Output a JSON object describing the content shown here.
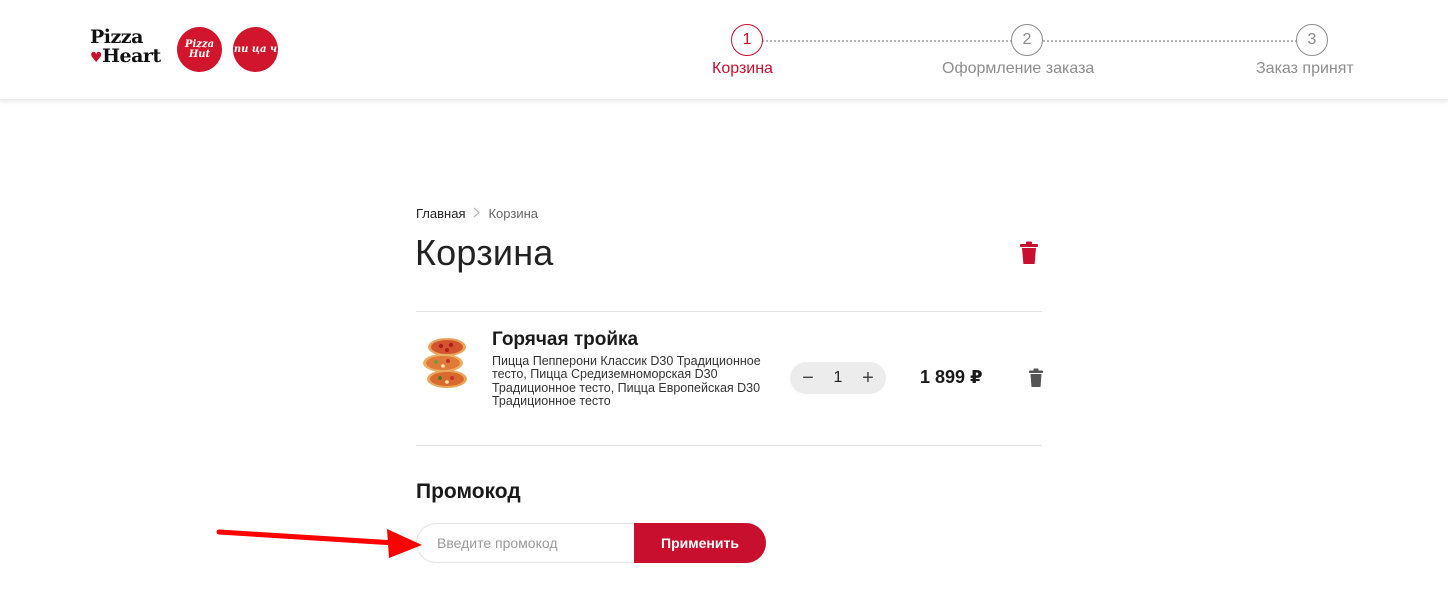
{
  "brand": {
    "logo_line1": "Pizza",
    "logo_heart": "♥",
    "logo_line2": "Heart",
    "logo_pizza_hut": "Pizza Hut",
    "logo_pitstsa": "пи ца ч"
  },
  "stepper": [
    {
      "number": "1",
      "label": "Корзина",
      "active": true
    },
    {
      "number": "2",
      "label": "Оформление заказа",
      "active": false
    },
    {
      "number": "3",
      "label": "Заказ принят",
      "active": false
    }
  ],
  "breadcrumb": {
    "home": "Главная",
    "current": "Корзина"
  },
  "page_title": "Корзина",
  "cart": {
    "items": [
      {
        "title": "Горячая тройка",
        "description": "Пицца Пепперони Классик D30 Традиционное тесто, Пицца Средиземноморская D30 Традиционное тесто, Пицца Европейская D30 Традиционное тесто",
        "quantity": "1",
        "price": "1 899 ₽",
        "minus": "−",
        "plus": "+"
      }
    ]
  },
  "promo": {
    "title": "Промокод",
    "placeholder": "Введите промокод",
    "value": "",
    "apply_label": "Применить"
  },
  "colors": {
    "accent": "#c8102e",
    "annotation_arrow": "#ff0000"
  },
  "icons": {
    "clear_cart": "trash-icon",
    "item_delete": "trash-icon",
    "breadcrumb_separator": "chevron-right-icon"
  }
}
